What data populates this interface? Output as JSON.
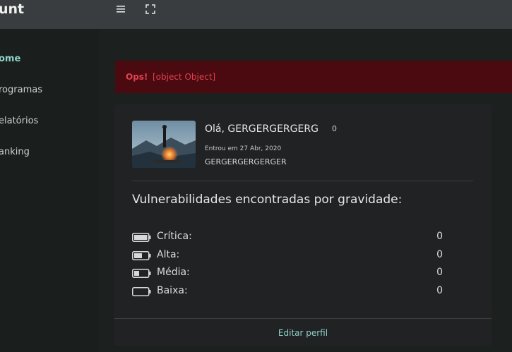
{
  "app": {
    "brand": "unt"
  },
  "topbar": {
    "menu_icon": "hamburger-icon",
    "fullscreen_icon": "fullscreen-icon"
  },
  "sidebar": {
    "items": [
      {
        "label": "ome",
        "active": true
      },
      {
        "label": "rogramas"
      },
      {
        "label": "elatórios"
      },
      {
        "label": "anking"
      }
    ]
  },
  "alert": {
    "title": "Ops!",
    "message": "[object Object]",
    "color": "#e0414f",
    "background": "#4a0a10"
  },
  "profile": {
    "greeting": "Olá, GERGERGERGERG",
    "points": "0",
    "joined": "Entrou em 27 Abr, 2020",
    "handle": "GERGERGERGERGER"
  },
  "vulnerabilities": {
    "title": "Vulnerabilidades encontradas por gravidade:",
    "rows": [
      {
        "label": "Crítica:",
        "count": "0",
        "level": 1.0
      },
      {
        "label": "Alta:",
        "count": "0",
        "level": 0.6
      },
      {
        "label": "Média:",
        "count": "0",
        "level": 0.4
      },
      {
        "label": "Baixa:",
        "count": "0",
        "level": 0.0
      }
    ]
  },
  "footer": {
    "edit_label": "Editar perfil"
  },
  "colors": {
    "accent": "#8fd3c8",
    "card": "#202224",
    "topbar": "#3a3d3f"
  }
}
